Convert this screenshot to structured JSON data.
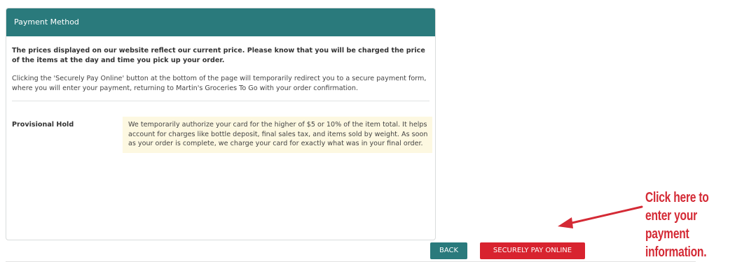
{
  "payment_panel": {
    "title": "Payment Method",
    "notice": "The prices displayed on our website reflect our current price. Please know that you will be charged the price of the items at the day and time you pick up your order.",
    "detail": "Clicking the 'Securely Pay Online' button at the bottom of the page will temporarily redirect you to a secure payment form, where you will enter your payment, returning to Martin's Groceries To Go with your order confirmation.",
    "hold": {
      "label": "Provisional Hold",
      "text": "We temporarily authorize your card for the higher of $5 or 10% of the item total. It helps account for charges like bottle deposit, final sales tax, and items sold by weight. As soon as your order is complete, we charge your card for exactly what was in your final order."
    }
  },
  "actions": {
    "back_label": "BACK",
    "pay_label": "SECURELY PAY ONLINE"
  },
  "annotation": {
    "text": "Click here to enter your payment information."
  },
  "colors": {
    "header_teal": "#2a7a7c",
    "pay_red": "#d8232f",
    "hold_background": "#fdf8e1",
    "annotation_red": "#d42a35"
  }
}
